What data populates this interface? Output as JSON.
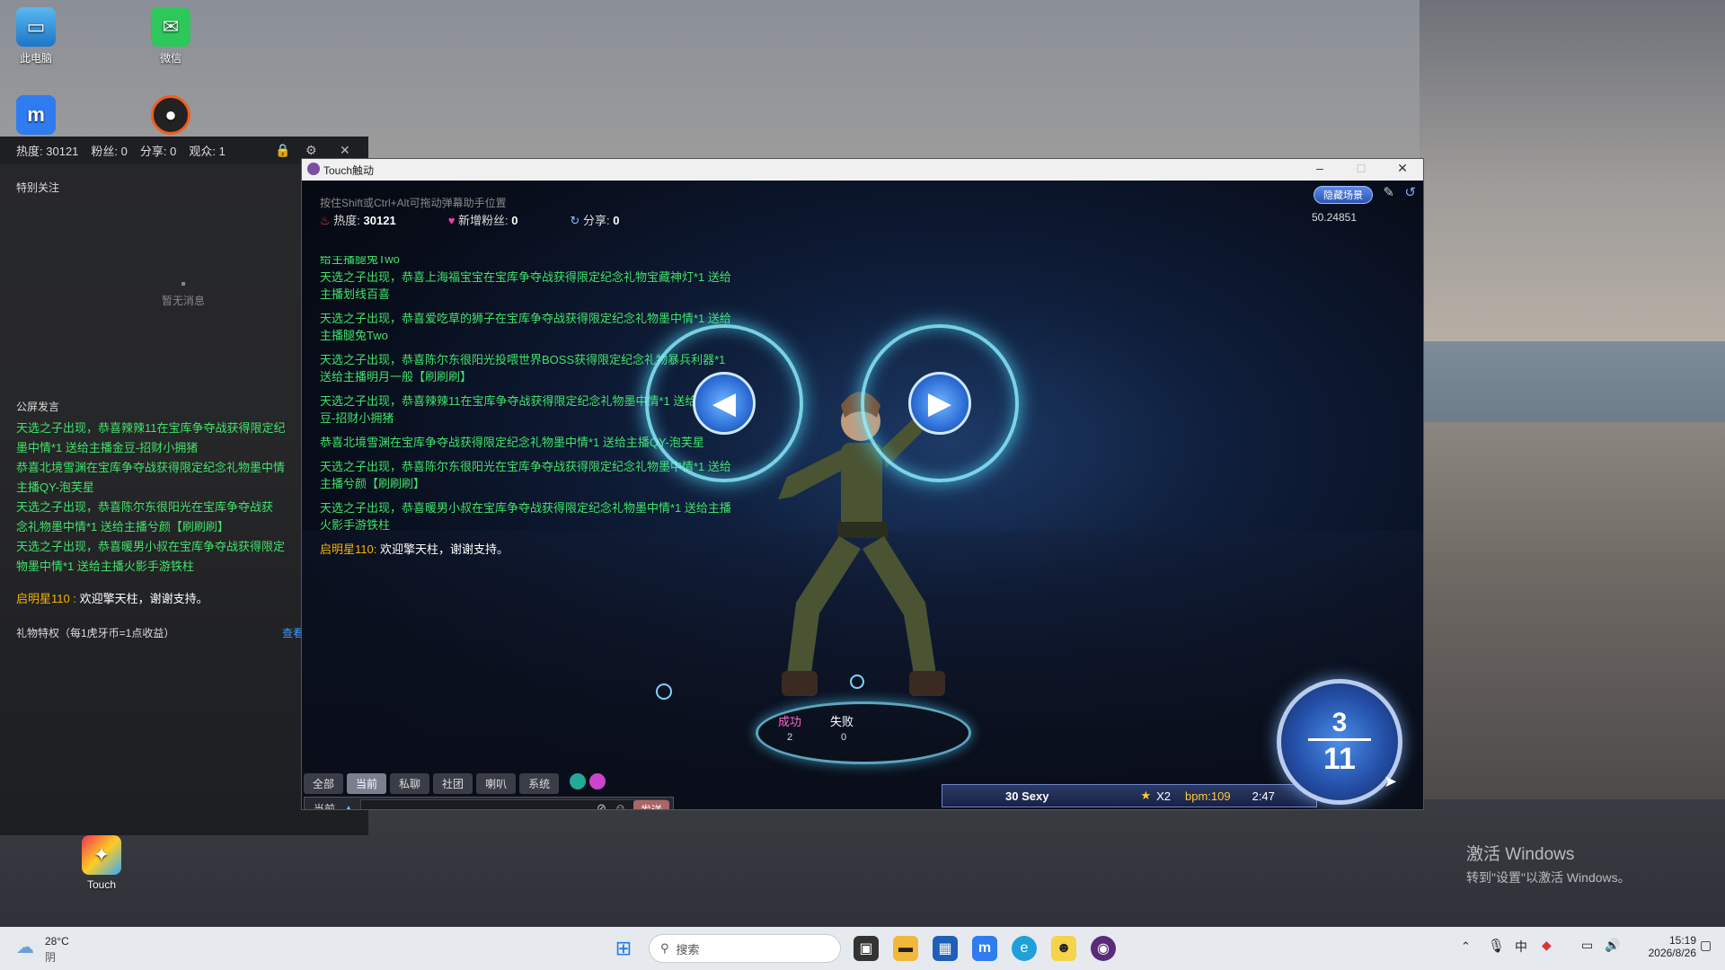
{
  "desktop": {
    "icons": [
      {
        "label": "此电脑",
        "icon": "monitor-icon"
      },
      {
        "label": "微信",
        "icon": "wechat-icon"
      },
      {
        "label": "Touch",
        "icon": "touch-app-icon"
      }
    ]
  },
  "stream_panel": {
    "stats": {
      "heat_label": "热度:",
      "heat": "30121",
      "fans_label": "粉丝:",
      "fans": "0",
      "share_label": "分享:",
      "share": "0",
      "viewers_label": "观众:",
      "viewers": "1"
    },
    "special_follow_title": "特别关注",
    "empty_text": "暂无消息",
    "public_chat_title": "公屏发言",
    "public_chat_lines": [
      "天选之子出现，恭喜辣辣11在宝库争夺战获得限定纪",
      "墨中情*1 送给主播金豆-招财小拥猪",
      "恭喜北境雪渊在宝库争夺战获得限定纪念礼物墨中情",
      "主播QY-泡芙星",
      "天选之子出现，恭喜陈尔东很阳光在宝库争夺战获",
      "念礼物墨中情*1 送给主播兮颜【刷刷刷】",
      "天选之子出现，恭喜暖男小叔在宝库争夺战获得限定",
      "物墨中情*1 送给主播火影手游铁柱"
    ],
    "welcome_user": "启明星110",
    "welcome_text": "欢迎擎天柱，谢谢支持。",
    "gift_privilege": "礼物特权（每1虎牙币=1点收益）",
    "view_link": "查看"
  },
  "game_window": {
    "title": "Touch触动",
    "hint": "按住Shift或Ctrl+Alt可拖动弹幕助手位置",
    "heat_label": "热度:",
    "heat": "30121",
    "new_fans_label": "新增粉丝:",
    "new_fans": "0",
    "share_label": "分享:",
    "share": "0",
    "hide_scene_button": "隐藏场景",
    "version": "50.24851",
    "chat_lines": [
      "给主播腿兔Two",
      "天选之子出现，恭喜上海福宝宝在宝库争夺战获得限定纪念礼物宝藏神灯*1 送给主播划线百喜",
      "天选之子出现，恭喜爱吃草的狮子在宝库争夺战获得限定纪念礼物墨中情*1 送给主播腿兔Two",
      "天选之子出现，恭喜陈尔东很阳光投喂世界BOSS获得限定纪念礼物暴兵利器*1 送给主播明月一般【刷刷刷】",
      "天选之子出现，恭喜辣辣11在宝库争夺战获得限定纪念礼物墨中情*1 送给主播金豆-招财小拥猪",
      "恭喜北境雪渊在宝库争夺战获得限定纪念礼物墨中情*1 送给主播QY-泡芙星",
      "天选之子出现，恭喜陈尔东很阳光在宝库争夺战获得限定纪念礼物墨中情*1 送给主播兮颜【刷刷刷】",
      "天选之子出现，恭喜暖男小叔在宝库争夺战获得限定纪念礼物墨中情*1 送给主播火影手游铁柱"
    ],
    "welcome_user": "启明星110",
    "welcome_text": "欢迎擎天柱，谢谢支持。",
    "success_label": "成功",
    "success_count": "2",
    "fail_label": "失败",
    "fail_count": "0",
    "tabs": [
      "全部",
      "当前",
      "私聊",
      "社团",
      "喇叭",
      "系统"
    ],
    "channel_label": "当前",
    "send_button": "发送",
    "song_title": "30 Sexy",
    "multiplier": "X2",
    "bpm": "bpm:109",
    "time": "2:47",
    "combo_top": "3",
    "combo_bottom": "11"
  },
  "watermark": {
    "line1": "激活 Windows",
    "line2": "转到\"设置\"以激活 Windows。"
  },
  "taskbar": {
    "weather_temp": "28°C",
    "weather_desc": "阴",
    "search_placeholder": "搜索",
    "time": "15:19",
    "date": "2026/8/26"
  }
}
